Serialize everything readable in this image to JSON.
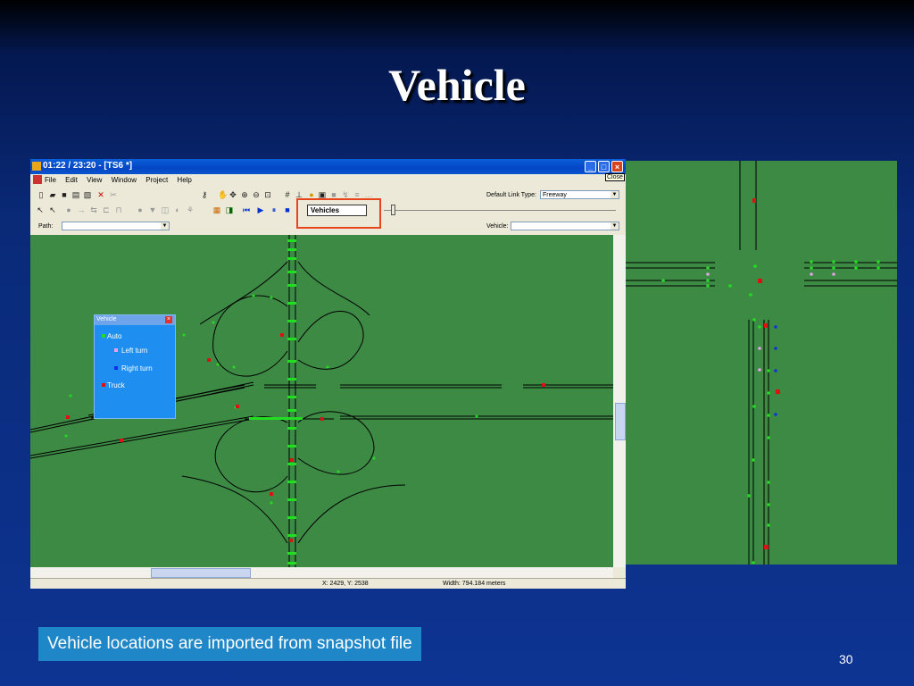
{
  "slide": {
    "title": "Vehicle",
    "caption": "Vehicle locations are imported from snapshot file",
    "page_number": "30"
  },
  "window": {
    "title": "01:22 / 23:20 - [TS6 *]",
    "tooltip": "Close",
    "menu": [
      "File",
      "Edit",
      "View",
      "Window",
      "Project",
      "Help"
    ],
    "default_link_type_label": "Default Link Type:",
    "default_link_type_value": "Freeway",
    "layer_value": "Vehicles",
    "path_label": "Path:",
    "vehicle_label": "Vehicle:"
  },
  "legend": {
    "title": "Vehicle",
    "items": [
      {
        "label": "Auto",
        "color": "#22dd22"
      },
      {
        "label": "Left turn",
        "color": "#e8a0e8"
      },
      {
        "label": "Right turn",
        "color": "#1030e0"
      },
      {
        "label": "Truck",
        "color": "#dd1111"
      }
    ]
  },
  "status": {
    "coords": "X: 2429, Y: 2538",
    "width": "Width: 794.184 meters"
  },
  "colors": {
    "canvas": "#3d8a44",
    "auto": "#22dd22",
    "truck": "#dd1111",
    "left": "#e8a0e8",
    "right": "#1030e0",
    "highlight": "#e8451c"
  }
}
